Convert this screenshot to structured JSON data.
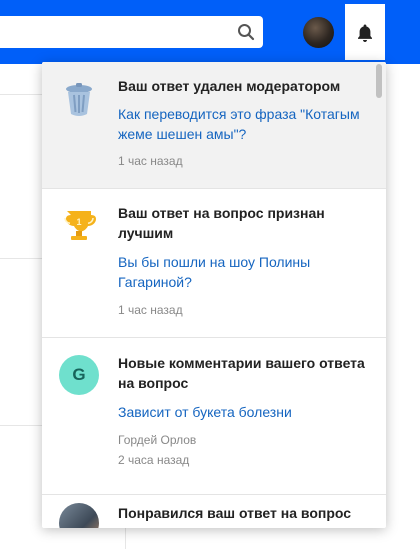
{
  "colors": {
    "brand_blue": "#005ff9",
    "link": "#1565c0",
    "avatar_letter_bg": "#6fe0cd"
  },
  "header": {
    "search_icon": "search-icon",
    "bell_icon": "bell-icon"
  },
  "notifications": [
    {
      "icon": "trash-icon",
      "title": "Ваш ответ удален модератором",
      "link": "Как переводится это фраза \"Котагым жеме шешен амы\"?",
      "time": "1 час назад"
    },
    {
      "icon": "trophy-icon",
      "title": "Ваш ответ на вопрос признан лучшим",
      "link": "Вы бы пошли на шоу Полины Гагариной?",
      "time": "1 час назад"
    },
    {
      "avatar_letter": "G",
      "title": "Новые комментарии вашего ответа на вопрос",
      "link": "Зависит от букета болезни",
      "author": "Гордей Орлов",
      "time": "2 часа назад"
    },
    {
      "icon": "user-avatar",
      "title": "Понравился ваш ответ на вопрос"
    }
  ]
}
